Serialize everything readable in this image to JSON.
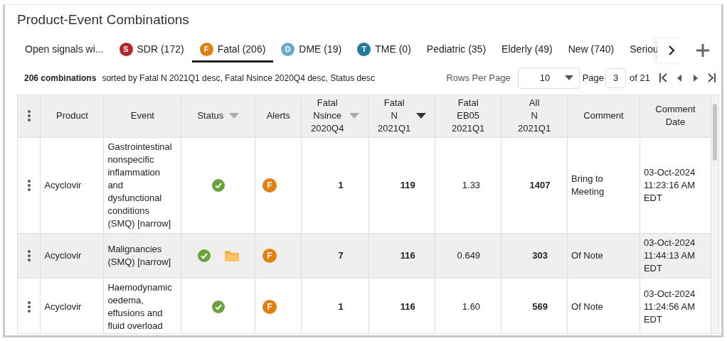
{
  "title": "Product-Event Combinations",
  "tabs": [
    {
      "label": "Open signals wi...",
      "selected": false
    },
    {
      "label": "SDR (172)",
      "badge": "S",
      "color": "#b0282a",
      "selected": false
    },
    {
      "label": "Fatal (206)",
      "badge": "F",
      "color": "#e0800f",
      "selected": true
    },
    {
      "label": "DME (19)",
      "badge": "D",
      "color": "#68a9c8",
      "selected": false
    },
    {
      "label": "TME (0)",
      "badge": "T",
      "color": "#237a9c",
      "selected": false
    },
    {
      "label": "Pediatric (35)",
      "selected": false
    },
    {
      "label": "Elderly (49)",
      "selected": false
    },
    {
      "label": "New (740)",
      "selected": false
    },
    {
      "label": "Seriou",
      "selected": false
    }
  ],
  "summary": {
    "count": "206 combinations",
    "sorted_by": "sorted by Fatal N 2021Q1 desc, Fatal Nsince 2020Q4 desc, Status desc"
  },
  "pagination": {
    "rows_label": "Rows Per Page",
    "rows_per_page": "10",
    "page_label": "Page",
    "page": "3",
    "of": "of 21"
  },
  "table": {
    "columns": [
      {
        "label": "Product",
        "kind": "text",
        "sorted": false
      },
      {
        "label": "Event",
        "kind": "text",
        "sorted": false
      },
      {
        "label": "Status",
        "kind": "status",
        "sorted": true,
        "primary": false
      },
      {
        "label": "Alerts",
        "kind": "alert",
        "sorted": false
      },
      {
        "label": "Fatal\nNsince\n2020Q4",
        "kind": "count",
        "sorted": true,
        "primary": false
      },
      {
        "label": "Fatal\nN\n2021Q1",
        "kind": "count",
        "sorted": true,
        "primary": true
      },
      {
        "label": "Fatal\nEB05\n2021Q1",
        "kind": "score",
        "sorted": false
      },
      {
        "label": "All\nN\n2021Q1",
        "kind": "count",
        "sorted": false
      },
      {
        "label": "Comment",
        "kind": "text",
        "sorted": false
      },
      {
        "label": "Comment\nDate",
        "kind": "text",
        "sorted": false
      }
    ],
    "rows": [
      {
        "selected": false,
        "cells": [
          "Acyclovir",
          "Gastrointestinal nonspecific inflammation and dysfunctional conditions (SMQ) [narrow]",
          {
            "reviewed": true,
            "folder": false
          },
          {
            "badge": "F",
            "color": "#e0800f"
          },
          "1",
          "119",
          "1.33",
          "1407",
          "Bring to Meeting",
          "03-Oct-2024\n11:23:16 AM\nEDT"
        ]
      },
      {
        "selected": true,
        "cells": [
          "Acyclovir",
          "Malignancies (SMQ) [narrow]",
          {
            "reviewed": true,
            "folder": true
          },
          {
            "badge": "F",
            "color": "#e0800f"
          },
          "7",
          "116",
          "0.649",
          "303",
          "Of Note",
          "03-Oct-2024\n11:44:13 AM\nEDT"
        ]
      },
      {
        "selected": false,
        "cells": [
          "Acyclovir",
          "Haemodynamic oedema, effusions and fluid overload",
          {
            "reviewed": true,
            "folder": false
          },
          {
            "badge": "F",
            "color": "#e0800f"
          },
          "1",
          "116",
          "1.60",
          "569",
          "Of Note",
          "03-Oct-2024\n11:24:56 AM\nEDT"
        ]
      }
    ]
  }
}
